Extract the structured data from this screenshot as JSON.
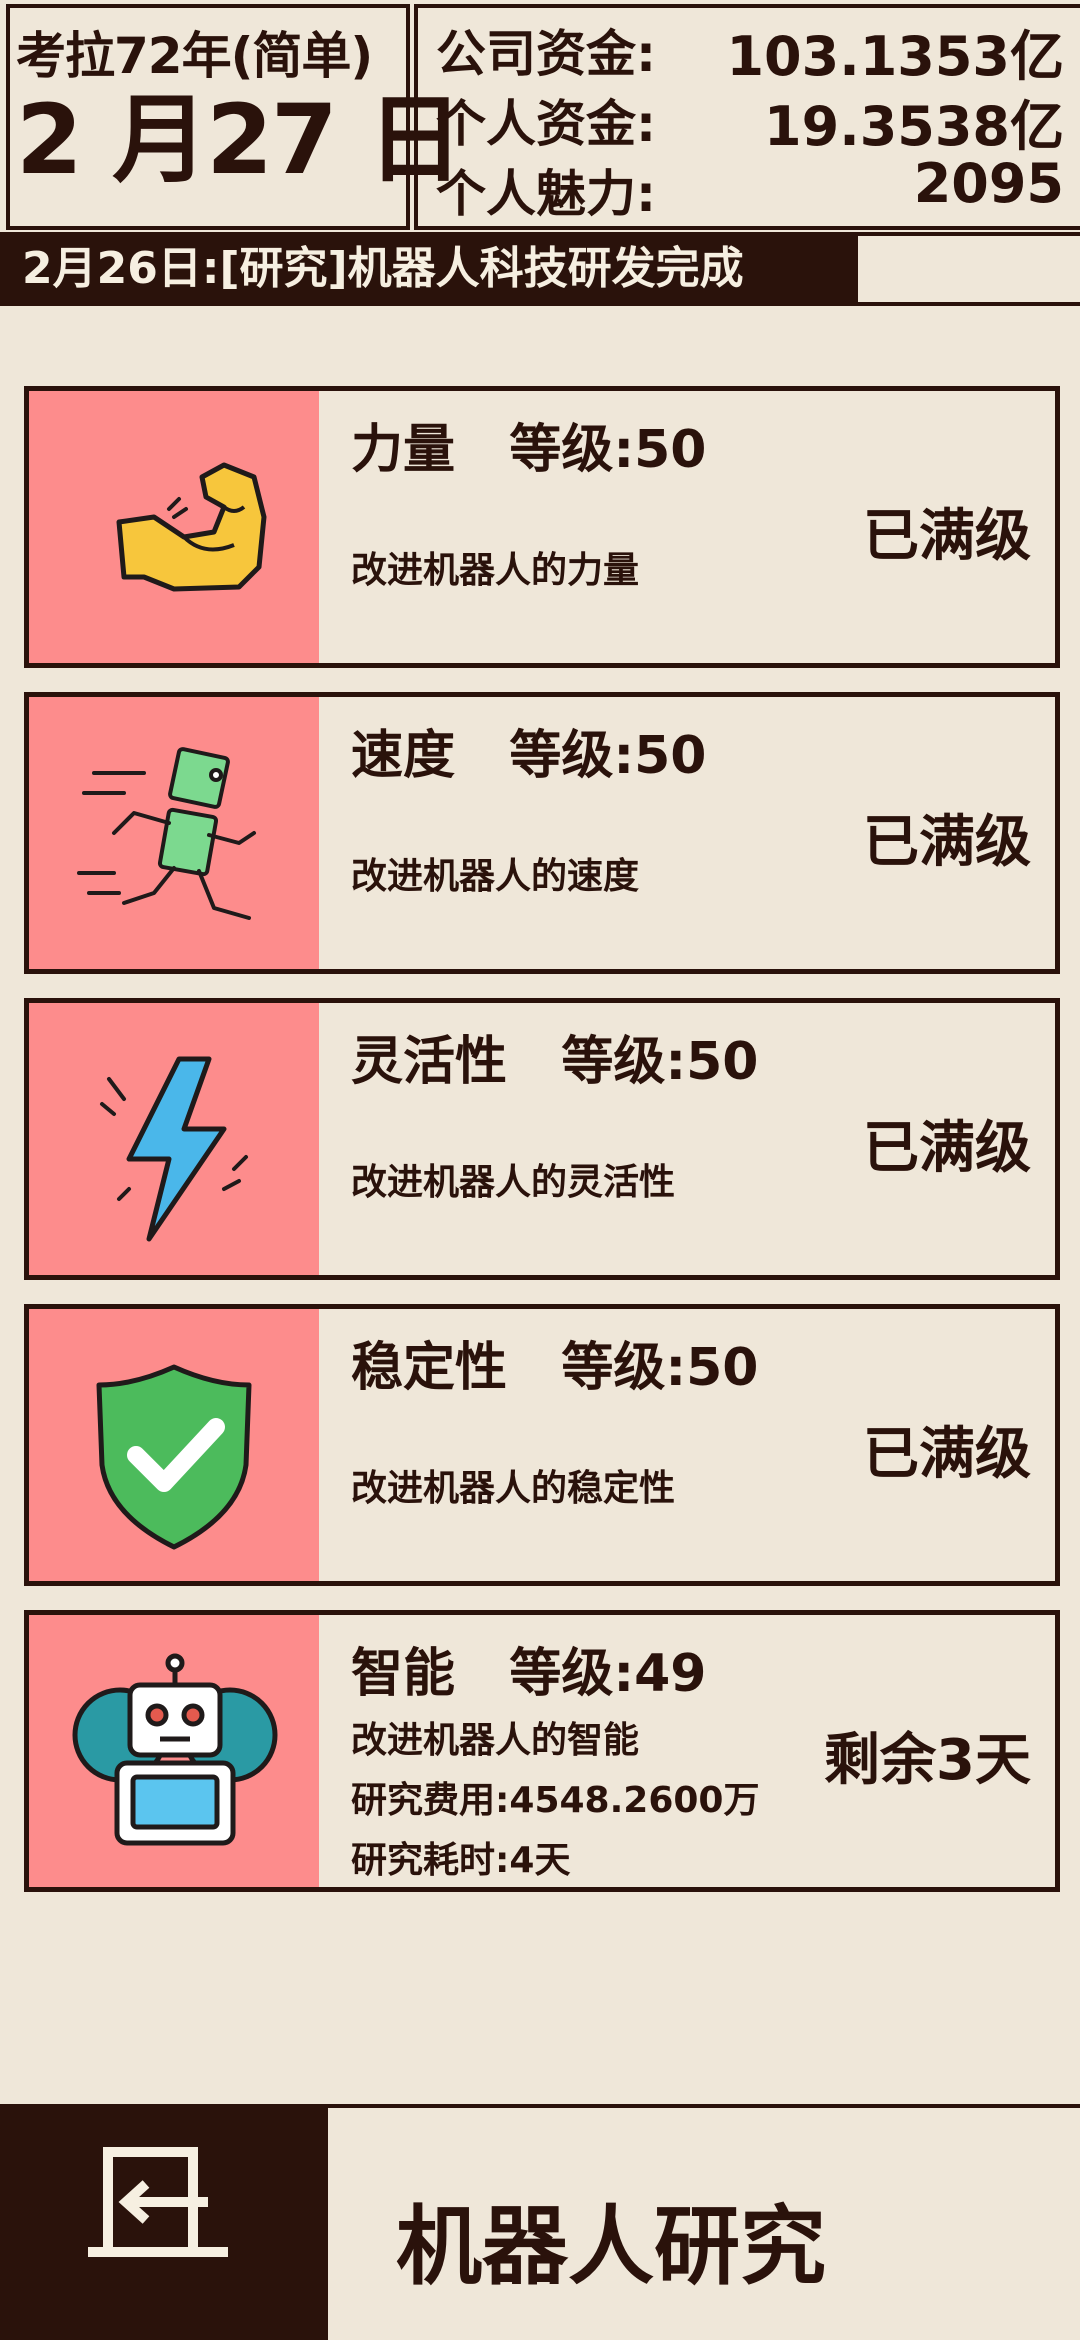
{
  "header": {
    "era": "考拉72年(简单)",
    "date": "2 月27 日",
    "stats": [
      {
        "label": "公司资金:",
        "value": "103.1353亿"
      },
      {
        "label": "个人资金:",
        "value": "19.3538亿"
      },
      {
        "label": "个人魅力:",
        "value": "2095"
      }
    ]
  },
  "news": "2月26日:[研究]机器人科技研发完成",
  "research": [
    {
      "name": "力量",
      "level": "等级:50",
      "desc": "改进机器人的力量",
      "status": "已满级",
      "icon": "muscle-arm-icon"
    },
    {
      "name": "速度",
      "level": "等级:50",
      "desc": "改进机器人的速度",
      "status": "已满级",
      "icon": "running-robot-icon"
    },
    {
      "name": "灵活性",
      "level": "等级:50",
      "desc": "改进机器人的灵活性",
      "status": "已满级",
      "icon": "lightning-icon"
    },
    {
      "name": "稳定性",
      "level": "等级:50",
      "desc": "改进机器人的稳定性",
      "status": "已满级",
      "icon": "shield-check-icon"
    },
    {
      "name": "智能",
      "level": "等级:49",
      "desc": "改进机器人的智能",
      "cost": "研究费用:4548.2600万",
      "time": "研究耗时:4天",
      "status": "剩余3天",
      "icon": "robot-gear-icon"
    }
  ],
  "footer": {
    "title": "机器人研究",
    "back_icon": "exit-door-icon"
  },
  "colors": {
    "background": "#efe7d9",
    "dark": "#2a120b",
    "card_icon_bg": "#fd8c8c"
  }
}
